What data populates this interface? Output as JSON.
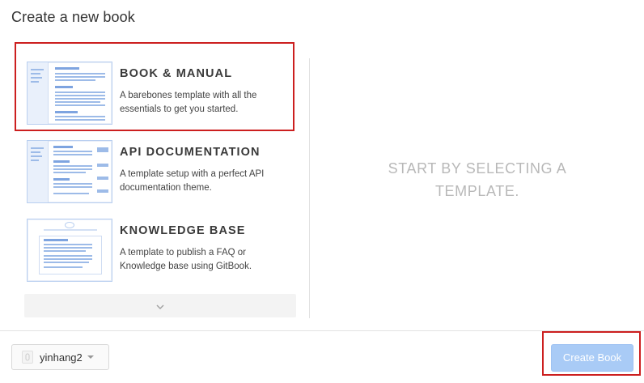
{
  "dialog": {
    "title": "Create a new book"
  },
  "templates": [
    {
      "name": "BOOK & MANUAL",
      "description": "A barebones template with all the essentials to get you started."
    },
    {
      "name": "API DOCUMENTATION",
      "description": "A template setup with a perfect API documentation theme."
    },
    {
      "name": "KNOWLEDGE BASE",
      "description": "A template to publish a FAQ or Knowledge base using GitBook."
    }
  ],
  "more": {
    "icon": "chevron-down-icon",
    "glyph": "⌄"
  },
  "preview": {
    "empty_text": "START BY SELECTING A TEMPLATE."
  },
  "footer": {
    "owner": {
      "label": "yinhang2",
      "icon": "avatar-icon"
    },
    "create_button": {
      "label": "Create Book"
    }
  },
  "colors": {
    "highlight": "#cc1f1f",
    "primary_disabled": "#a9cbf6",
    "thumb_accent": "#9dbbe8"
  }
}
